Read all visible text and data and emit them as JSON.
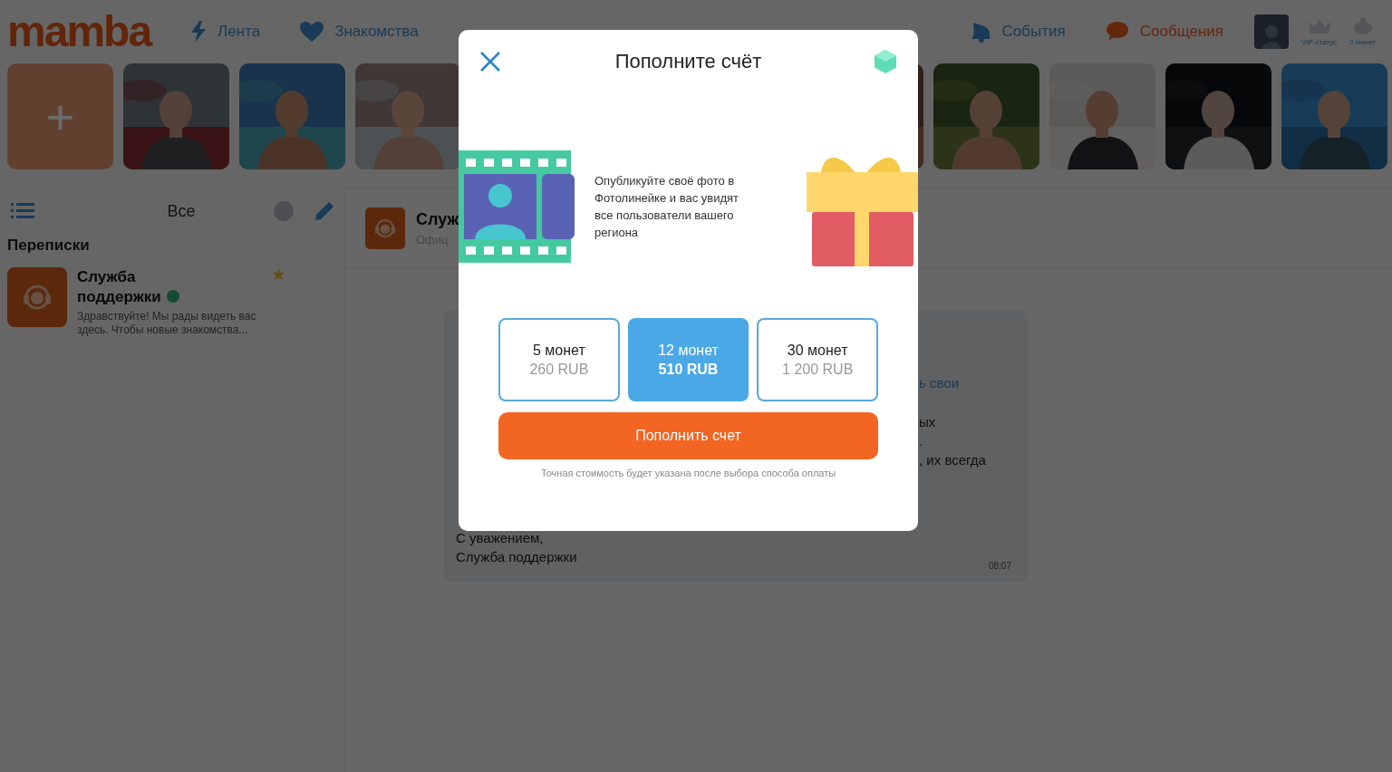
{
  "header": {
    "logo": "mamba",
    "nav": [
      {
        "label": "Лента",
        "kind": "bolt",
        "selected": false
      },
      {
        "label": "Знакомства",
        "kind": "heart",
        "selected": false
      }
    ],
    "nav_right": [
      {
        "label": "События",
        "kind": "bell",
        "selected": false
      },
      {
        "label": "Сообщения",
        "kind": "chat",
        "selected": true
      }
    ],
    "vip": "VIP-статус",
    "coins": "0 монет"
  },
  "photos": {
    "add": "+"
  },
  "sidebar": {
    "filter": "Все",
    "title": "Переписки",
    "chats": [
      {
        "name": "Служба поддержки",
        "online": true,
        "starred": true,
        "preview": "Здравствуйте! Мы рады видеть вас здесь. Чтобы новые знакомства..."
      }
    ]
  },
  "chat": {
    "name": "Служ",
    "subtitle": "Офиц",
    "message": {
      "fragments": [
        {
          "text": "ь свои",
          "kind": "link"
        },
        {
          "text": "ых",
          "kind": "text"
        },
        {
          "text": ".",
          "kind": "text"
        },
        {
          "text": ", их всегда",
          "kind": "text"
        }
      ],
      "signature": [
        "С уважением,",
        "Служба поддержки"
      ],
      "time": "08:07"
    }
  },
  "modal": {
    "title": "Пополните счёт",
    "promo": "Опубликуйте своё фото в Фотолинейке и вас увидят все пользователи вашего региона",
    "packages": [
      {
        "coins": "5 монет",
        "price": "260 RUB",
        "selected": false
      },
      {
        "coins": "12 монет",
        "price": "510 RUB",
        "selected": true
      },
      {
        "coins": "30 монет",
        "price": "1 200 RUB",
        "selected": false
      }
    ],
    "button": "Пополнить счет",
    "note": "Точная стоимость будет указана после выбора способа оплаты"
  }
}
